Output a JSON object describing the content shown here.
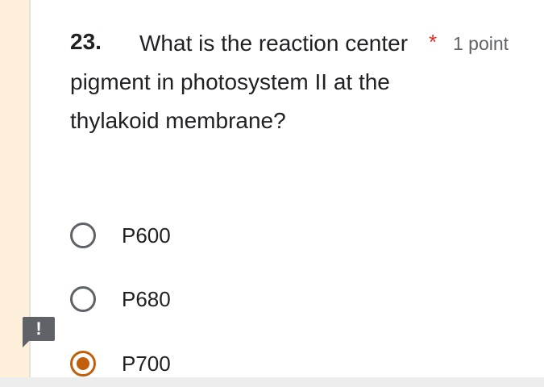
{
  "question": {
    "number": "23.",
    "text": "What is the reaction center pigment in photosystem II at the thylakoid membrane?",
    "required_marker": "*",
    "points": "1 point"
  },
  "options": [
    {
      "label": "P600",
      "selected": false
    },
    {
      "label": "P680",
      "selected": false
    },
    {
      "label": "P700",
      "selected": true
    }
  ],
  "alert": {
    "symbol": "!",
    "icon": "alert-icon"
  },
  "colors": {
    "accent": "#c25f0a",
    "required": "#d93025",
    "side_strip": "#fdefda",
    "text": "#202124",
    "muted": "#5f6368"
  }
}
